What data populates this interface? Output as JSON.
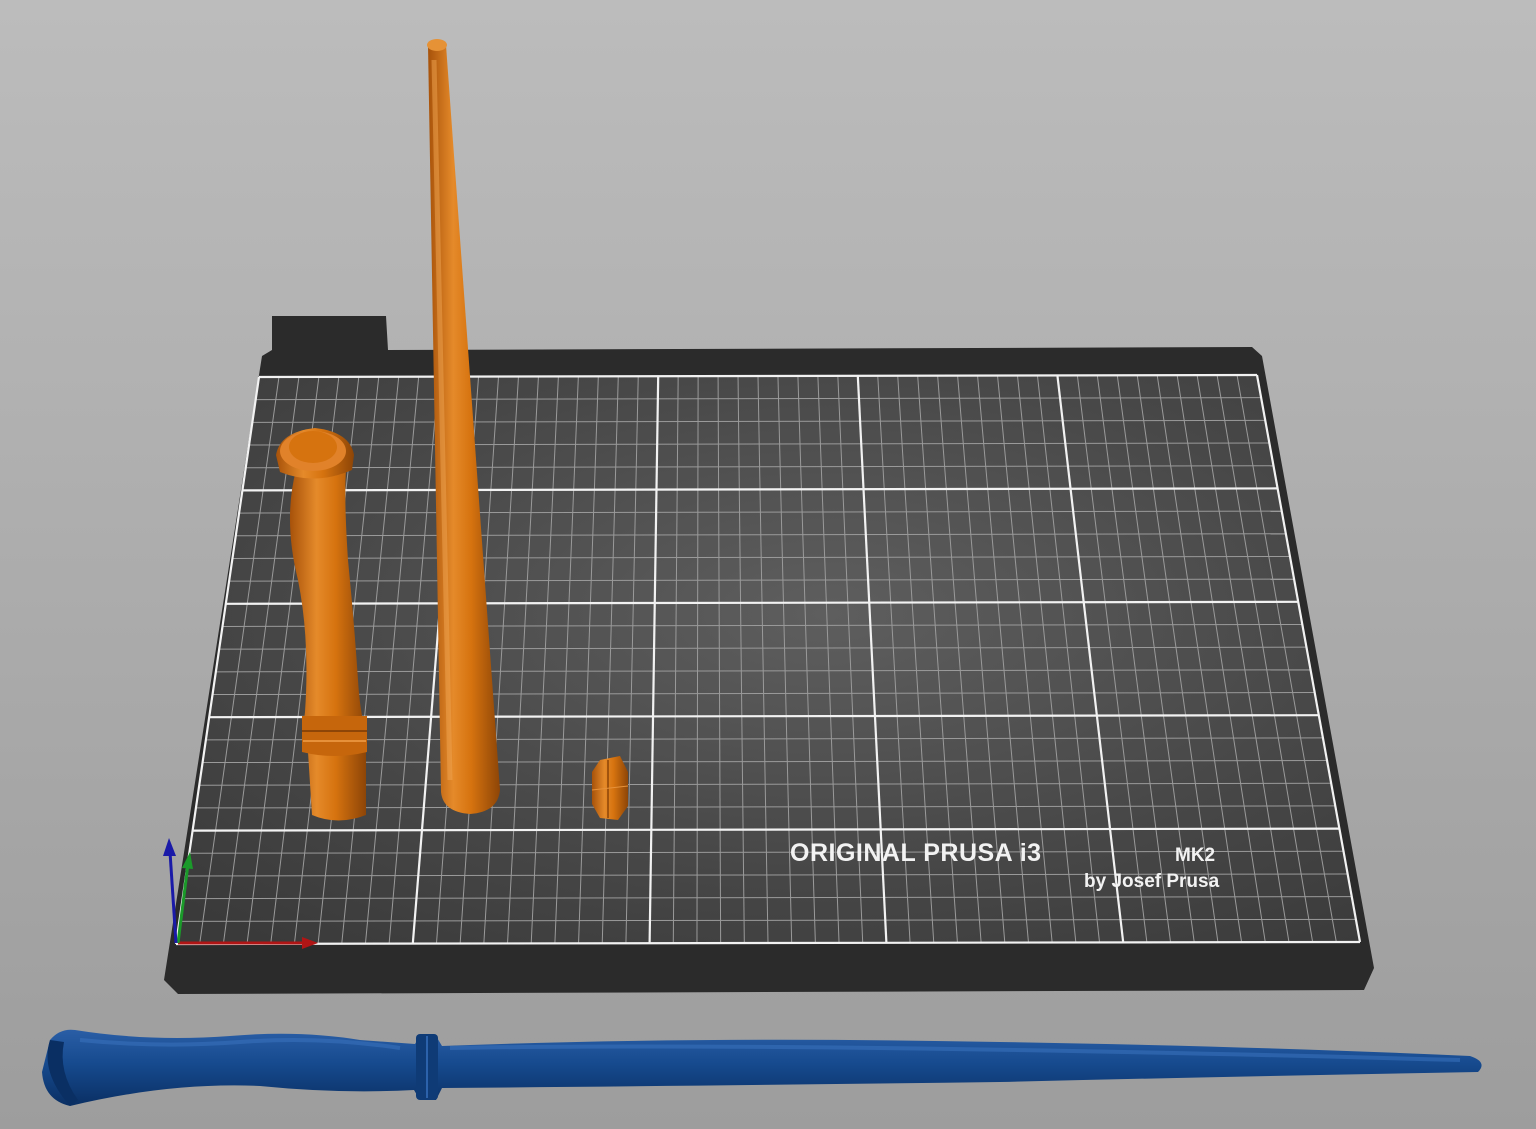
{
  "bed": {
    "logo_line1_main": "ORIGINAL PRUSA i3",
    "logo_line1_model": "MK2",
    "logo_line2": "by Josef Prusa"
  },
  "colors": {
    "background_top": "#bcbcbc",
    "background_bottom": "#9d9d9d",
    "bed_surface": "#474747",
    "bed_frame": "#2e2e2e",
    "grid_major": "#f2f2f2",
    "grid_minor": "#9a9a9a",
    "object_on_bed": "#d6730f",
    "object_off_bed": "#103f7e",
    "axis_x": "#b01515",
    "axis_y": "#1b9a2a",
    "axis_z": "#1a1aa8"
  },
  "objects": [
    {
      "name": "wand-handle",
      "state": "on-bed"
    },
    {
      "name": "wand-shaft",
      "state": "on-bed"
    },
    {
      "name": "small-hex-part",
      "state": "on-bed"
    },
    {
      "name": "assembled-wand",
      "state": "outside-bed"
    }
  ],
  "axes": [
    "x-axis",
    "y-axis",
    "z-axis"
  ]
}
